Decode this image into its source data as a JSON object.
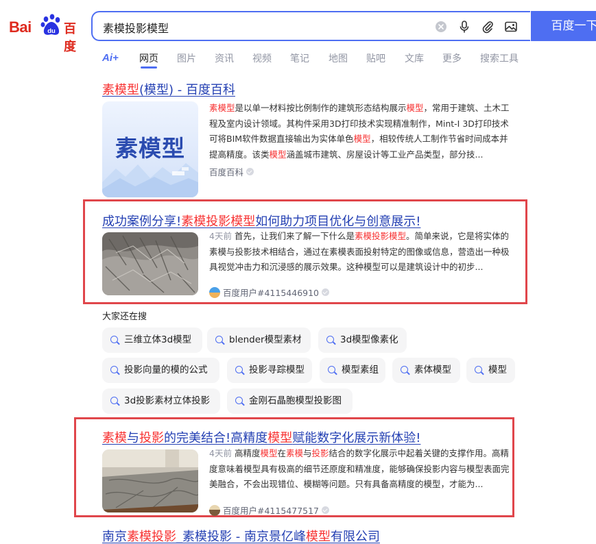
{
  "header": {
    "logo_latin": "Bai",
    "logo_paw_text": "du",
    "logo_cn": "百度",
    "query": "素模投影模型",
    "search_button": "百度一下"
  },
  "tabs": {
    "ai_label": "Ai+",
    "items": [
      "网页",
      "图片",
      "资讯",
      "视频",
      "笔记",
      "地图",
      "贴吧",
      "文库",
      "更多",
      "搜索工具"
    ],
    "active": "网页"
  },
  "results": [
    {
      "title_parts": [
        {
          "text": "素模型",
          "em": true
        },
        {
          "text": "(模型) - 百度百科",
          "em": false
        }
      ],
      "thumb_text": "素模型",
      "snippet_parts": [
        {
          "text": "素模型",
          "em": true
        },
        {
          "text": "是以单一材料按比例制作的建筑形态结构展示",
          "em": false
        },
        {
          "text": "模型",
          "em": true
        },
        {
          "text": "，常用于建筑、土木工程及室内设计领域。其构件采用3D打印技术实现精准制作，Mint-I 3D打印技术可将BIM软件数据直接输出为实体单色",
          "em": false
        },
        {
          "text": "模型",
          "em": true
        },
        {
          "text": "，相较传统人工制作节省时间成本并提高精度。该类",
          "em": false
        },
        {
          "text": "模型",
          "em": true
        },
        {
          "text": "涵盖城市建筑、房屋设计等工业产品类型，部分技...",
          "em": false
        }
      ],
      "source": "百度百科"
    },
    {
      "title_parts": [
        {
          "text": "成功案例分享!",
          "em": false
        },
        {
          "text": "素模投影模型",
          "em": true
        },
        {
          "text": "如何助力项目优化与创意展示!",
          "em": false
        }
      ],
      "date": "4天前",
      "snippet_parts": [
        {
          "text": "首先，让我们来了解一下什么是",
          "em": false
        },
        {
          "text": "素模投影模型",
          "em": true
        },
        {
          "text": "。简单来说，它是将实体的素模与投影技术相结合，通过在素模表面投射特定的图像或信息，营造出一种极具视觉冲击力和沉浸感的展示效果。这种模型可以是建筑设计中的初步...",
          "em": false
        }
      ],
      "source": "百度用户#4115446910"
    },
    {
      "title_parts": [
        {
          "text": "素模",
          "em": true
        },
        {
          "text": "与",
          "em": false
        },
        {
          "text": "投影",
          "em": true
        },
        {
          "text": "的完美结合!高精度",
          "em": false
        },
        {
          "text": "模型",
          "em": true
        },
        {
          "text": "赋能数字化展示新体验!",
          "em": false
        }
      ],
      "date": "4天前",
      "snippet_parts": [
        {
          "text": "高精度",
          "em": false
        },
        {
          "text": "模型",
          "em": true
        },
        {
          "text": "在",
          "em": false
        },
        {
          "text": "素模",
          "em": true
        },
        {
          "text": "与",
          "em": false
        },
        {
          "text": "投影",
          "em": true
        },
        {
          "text": "结合的数字化展示中起着关键的支撑作用。高精度意味着模型具有极高的细节还原度和精准度，能够确保投影内容与模型表面完美融合，不会出现错位、模糊等问题。只有具备高精度的模型，才能为...",
          "em": false
        }
      ],
      "source": "百度用户#4115477517"
    },
    {
      "title_parts": [
        {
          "text": "南京",
          "em": false
        },
        {
          "text": "素模投影",
          "em": true
        },
        {
          "text": "_素模投影 - 南京景亿峰",
          "em": false
        },
        {
          "text": "模型",
          "em": true
        },
        {
          "text": "有限公司",
          "em": false
        }
      ]
    }
  ],
  "related": {
    "title": "大家还在搜",
    "chips": [
      "三维立体3d模型",
      "blender模型素材",
      "3d模型像素化",
      "投影向量的模的公式",
      "投影寻踪模型",
      "模型素组",
      "素体模型",
      "模型",
      "3d投影素材立体投影",
      "金刚石晶胞模型投影图"
    ]
  },
  "colors": {
    "brand_blue": "#4e6ef2",
    "title_blue": "#2440b3",
    "highlight_red": "#f73131",
    "annotation_box": "#e0464b"
  }
}
